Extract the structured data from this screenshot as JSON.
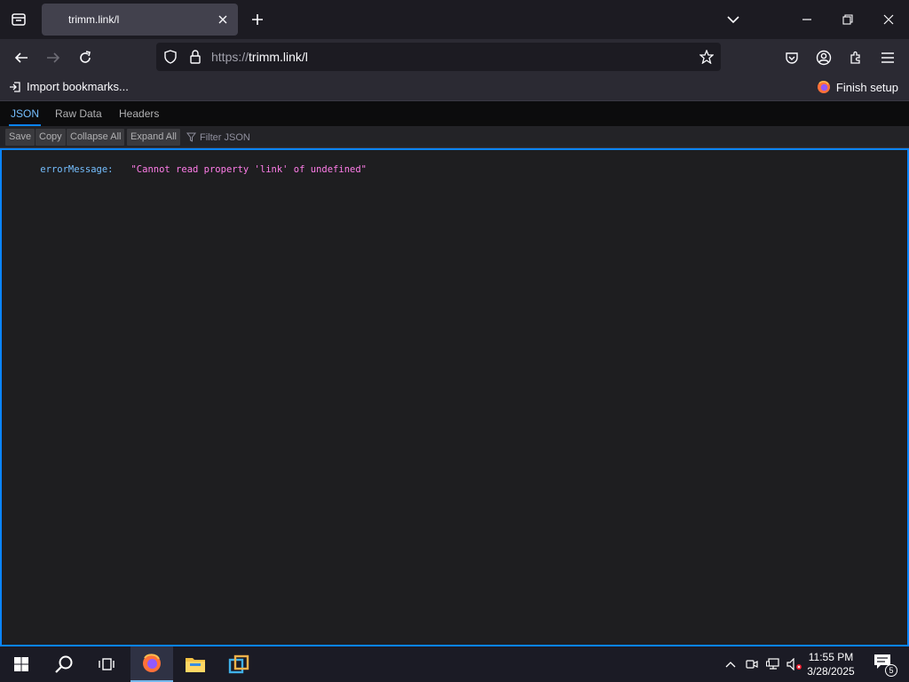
{
  "browser": {
    "tab": {
      "title": "trimm.link/l"
    },
    "url": {
      "scheme": "https://",
      "host": "trimm.link/l"
    }
  },
  "bookmarks": {
    "import_label": "Import bookmarks...",
    "finish_label": "Finish setup"
  },
  "viewer": {
    "tabs": [
      {
        "label": "JSON",
        "active": true
      },
      {
        "label": "Raw Data",
        "active": false
      },
      {
        "label": "Headers",
        "active": false
      }
    ],
    "toolbar": {
      "save": "Save",
      "copy": "Copy",
      "collapse_all": "Collapse All",
      "expand_all": "Expand All",
      "filter_placeholder": "Filter JSON"
    },
    "rows": [
      {
        "key": "errorMessage:",
        "value": "\"Cannot read property 'link' of undefined\""
      }
    ]
  },
  "taskbar": {
    "time": "11:55 PM",
    "date": "3/28/2025",
    "notification_count": "5"
  },
  "colors": {
    "accent": "#0a84ff",
    "json_key": "#75bfff",
    "json_string": "#ff7de9"
  }
}
